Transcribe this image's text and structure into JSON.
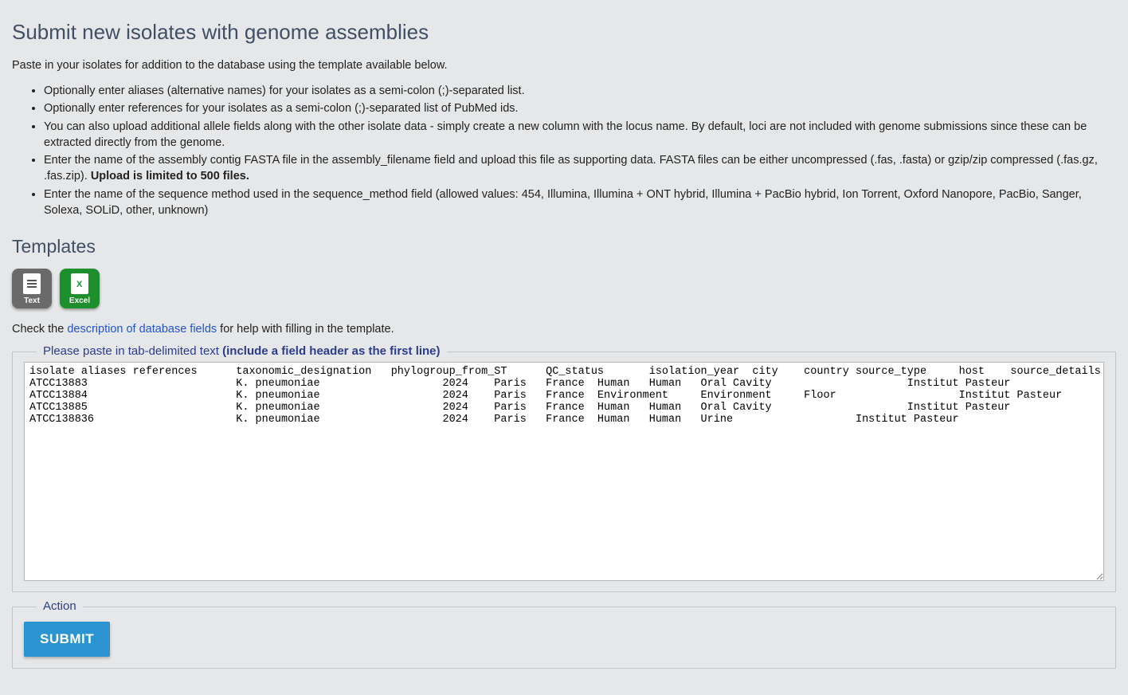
{
  "title": "Submit new isolates with genome assemblies",
  "intro": "Paste in your isolates for addition to the database using the template available below.",
  "instructions": [
    {
      "text": "Optionally enter aliases (alternative names) for your isolates as a semi-colon (;)-separated list."
    },
    {
      "text": "Optionally enter references for your isolates as a semi-colon (;)-separated list of PubMed ids."
    },
    {
      "text": "You can also upload additional allele fields along with the other isolate data - simply create a new column with the locus name. By default, loci are not included with genome submissions since these can be extracted directly from the genome."
    },
    {
      "text": "Enter the name of the assembly contig FASTA file in the assembly_filename field and upload this file as supporting data. FASTA files can be either uncompressed (.fas, .fasta) or gzip/zip compressed (.fas.gz, .fas.zip). ",
      "bold_suffix": "Upload is limited to 500 files."
    },
    {
      "text": "Enter the name of the sequence method used in the sequence_method field (allowed values: 454, Illumina, Illumina + ONT hybrid, Illumina + PacBio hybrid, Ion Torrent, Oxford Nanopore, PacBio, Sanger, Solexa, SOLiD, other, unknown)"
    }
  ],
  "templates_heading": "Templates",
  "template_icons": {
    "text": "Text",
    "excel": "Excel"
  },
  "help_prefix": "Check the ",
  "help_link_text": "description of database fields",
  "help_suffix": " for help with filling in the template.",
  "paste_legend_prefix": "Please paste in tab-delimited text ",
  "paste_legend_bold": "(include a field header as the first line)",
  "textarea_value": "isolate\taliases\treferences\ttaxonomic_designation\tphylogroup_from_ST\tQC_status\tisolation_year\tcity\tcountry\tsource_type\thost\tsource_details\tinfection\tother_source_info\tsource_lab\tresistance_info\tvirulence_info\tK_type\tK_typing_method\tduplicate_number\tcomments\taccession_number\tassembly_filename\tsequence_method\nATCC13883\t\t\tK. pneumoniae\t\t\t2024\tParis\tFrance\tHuman\tHuman\tOral Cavity\t\t\tInstitut Pasteur\t\t\t\t\t\t\t\tATCC13883.fas\tIllumina\nATCC13884\t\t\tK. pneumoniae\t\t\t2024\tParis\tFrance\tEnvironment\tEnvironment\tFloor\t\t\tInstitut Pasteur\t\t\t\t\t\t\t\tATCC13884.fas\tIllumina\nATCC13885\t\t\tK. pneumoniae\t\t\t2024\tParis\tFrance\tHuman\tHuman\tOral Cavity\t\t\tInstitut Pasteur\t\t\t\t\t\t\t\tATCC13885.fas\tIllumina\nATCC138836\t\t\tK. pneumoniae\t\t\t2024\tParis\tFrance\tHuman\tHuman\tUrine\t\t\tInstitut Pasteur\t\t\t\t\t\t\t\tATCC138836.fas\tIllumina",
  "action_legend": "Action",
  "submit_label": "SUBMIT"
}
